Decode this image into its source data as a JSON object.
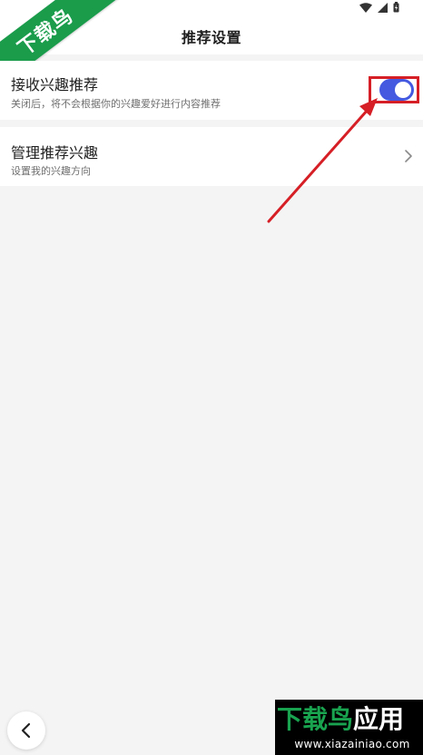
{
  "header": {
    "title": "推荐设置"
  },
  "watermark_top": {
    "text": "下载鸟"
  },
  "settings": {
    "interest_recommend": {
      "title": "接收兴趣推荐",
      "subtitle": "关闭后，将不会根据你的兴趣爱好进行内容推荐",
      "enabled": true
    },
    "manage_interest": {
      "title": "管理推荐兴趣",
      "subtitle": "设置我的兴趣方向"
    }
  },
  "watermark_bottom": {
    "title_green": "下载鸟",
    "title_white": "应用",
    "url": "www.xiazainiao.com"
  },
  "colors": {
    "toggle_on": "#4459e0",
    "annotation_red": "#d61f26",
    "brand_green": "#1a9c4b"
  },
  "icons": {
    "status": [
      "wifi-icon",
      "signal-icon",
      "battery-icon"
    ],
    "chevron": "chevron-right-icon",
    "back": "back-arrow-icon"
  }
}
